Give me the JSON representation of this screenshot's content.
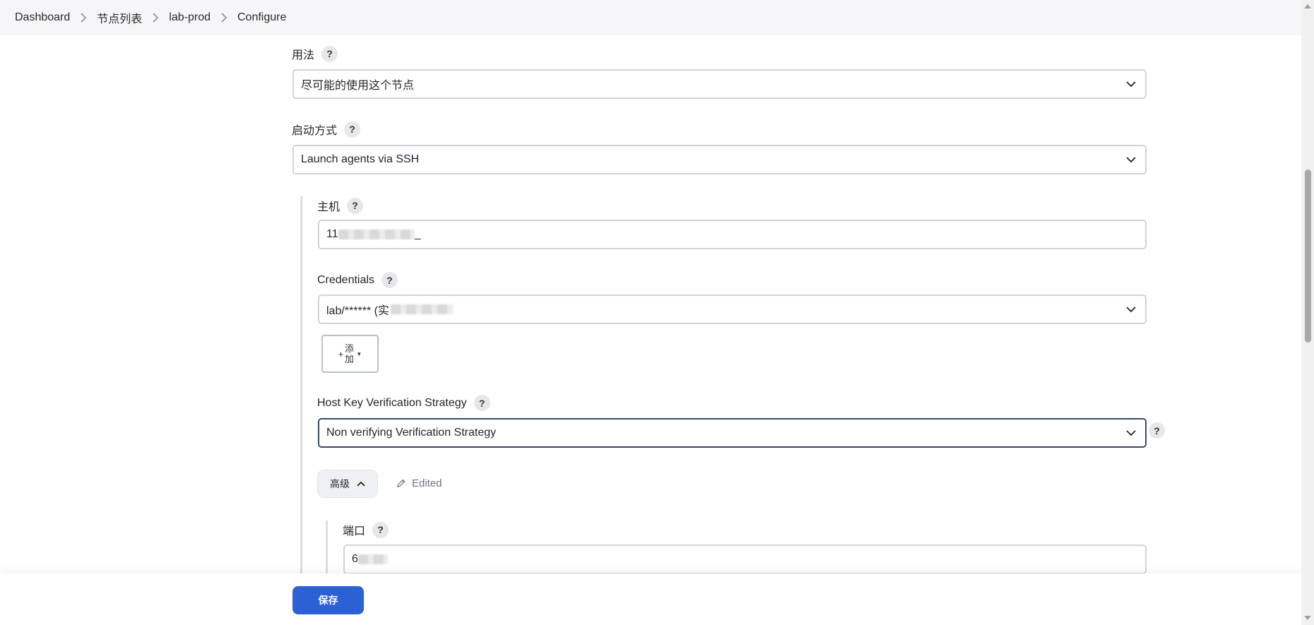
{
  "breadcrumb": [
    "Dashboard",
    "节点列表",
    "lab-prod",
    "Configure"
  ],
  "usage": {
    "label": "用法",
    "value": "尽可能的使用这个节点"
  },
  "launch": {
    "label": "启动方式",
    "value": "Launch agents via SSH"
  },
  "host": {
    "label": "主机",
    "value_prefix": "11",
    "value_suffix": "_"
  },
  "credentials": {
    "label": "Credentials",
    "value": "lab/****** (实"
  },
  "add_button": {
    "plus": "+",
    "label": "添加"
  },
  "host_key": {
    "label": "Host Key Verification Strategy",
    "value": "Non verifying Verification Strategy"
  },
  "advanced": {
    "label": "高级",
    "edited": "Edited"
  },
  "port": {
    "label": "端口",
    "value_prefix": "6"
  },
  "help_symbol": "?",
  "save_label": "保存",
  "colors": {
    "primary": "#2c61d6",
    "breadcrumb_bg": "#f6f6f8",
    "border": "#cfd3d8"
  }
}
